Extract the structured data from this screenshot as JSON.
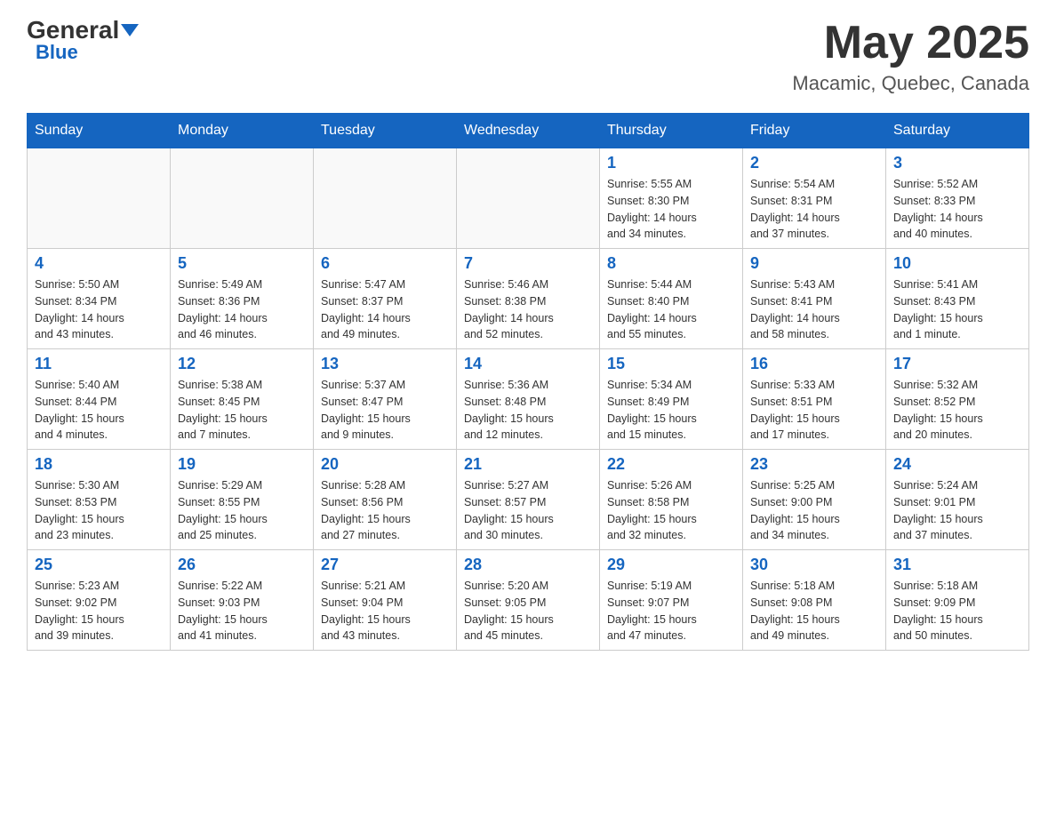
{
  "header": {
    "logo_general": "General",
    "logo_blue": "Blue",
    "month_title": "May 2025",
    "location": "Macamic, Quebec, Canada"
  },
  "weekdays": [
    "Sunday",
    "Monday",
    "Tuesday",
    "Wednesday",
    "Thursday",
    "Friday",
    "Saturday"
  ],
  "weeks": [
    [
      {
        "day": "",
        "info": ""
      },
      {
        "day": "",
        "info": ""
      },
      {
        "day": "",
        "info": ""
      },
      {
        "day": "",
        "info": ""
      },
      {
        "day": "1",
        "info": "Sunrise: 5:55 AM\nSunset: 8:30 PM\nDaylight: 14 hours\nand 34 minutes."
      },
      {
        "day": "2",
        "info": "Sunrise: 5:54 AM\nSunset: 8:31 PM\nDaylight: 14 hours\nand 37 minutes."
      },
      {
        "day": "3",
        "info": "Sunrise: 5:52 AM\nSunset: 8:33 PM\nDaylight: 14 hours\nand 40 minutes."
      }
    ],
    [
      {
        "day": "4",
        "info": "Sunrise: 5:50 AM\nSunset: 8:34 PM\nDaylight: 14 hours\nand 43 minutes."
      },
      {
        "day": "5",
        "info": "Sunrise: 5:49 AM\nSunset: 8:36 PM\nDaylight: 14 hours\nand 46 minutes."
      },
      {
        "day": "6",
        "info": "Sunrise: 5:47 AM\nSunset: 8:37 PM\nDaylight: 14 hours\nand 49 minutes."
      },
      {
        "day": "7",
        "info": "Sunrise: 5:46 AM\nSunset: 8:38 PM\nDaylight: 14 hours\nand 52 minutes."
      },
      {
        "day": "8",
        "info": "Sunrise: 5:44 AM\nSunset: 8:40 PM\nDaylight: 14 hours\nand 55 minutes."
      },
      {
        "day": "9",
        "info": "Sunrise: 5:43 AM\nSunset: 8:41 PM\nDaylight: 14 hours\nand 58 minutes."
      },
      {
        "day": "10",
        "info": "Sunrise: 5:41 AM\nSunset: 8:43 PM\nDaylight: 15 hours\nand 1 minute."
      }
    ],
    [
      {
        "day": "11",
        "info": "Sunrise: 5:40 AM\nSunset: 8:44 PM\nDaylight: 15 hours\nand 4 minutes."
      },
      {
        "day": "12",
        "info": "Sunrise: 5:38 AM\nSunset: 8:45 PM\nDaylight: 15 hours\nand 7 minutes."
      },
      {
        "day": "13",
        "info": "Sunrise: 5:37 AM\nSunset: 8:47 PM\nDaylight: 15 hours\nand 9 minutes."
      },
      {
        "day": "14",
        "info": "Sunrise: 5:36 AM\nSunset: 8:48 PM\nDaylight: 15 hours\nand 12 minutes."
      },
      {
        "day": "15",
        "info": "Sunrise: 5:34 AM\nSunset: 8:49 PM\nDaylight: 15 hours\nand 15 minutes."
      },
      {
        "day": "16",
        "info": "Sunrise: 5:33 AM\nSunset: 8:51 PM\nDaylight: 15 hours\nand 17 minutes."
      },
      {
        "day": "17",
        "info": "Sunrise: 5:32 AM\nSunset: 8:52 PM\nDaylight: 15 hours\nand 20 minutes."
      }
    ],
    [
      {
        "day": "18",
        "info": "Sunrise: 5:30 AM\nSunset: 8:53 PM\nDaylight: 15 hours\nand 23 minutes."
      },
      {
        "day": "19",
        "info": "Sunrise: 5:29 AM\nSunset: 8:55 PM\nDaylight: 15 hours\nand 25 minutes."
      },
      {
        "day": "20",
        "info": "Sunrise: 5:28 AM\nSunset: 8:56 PM\nDaylight: 15 hours\nand 27 minutes."
      },
      {
        "day": "21",
        "info": "Sunrise: 5:27 AM\nSunset: 8:57 PM\nDaylight: 15 hours\nand 30 minutes."
      },
      {
        "day": "22",
        "info": "Sunrise: 5:26 AM\nSunset: 8:58 PM\nDaylight: 15 hours\nand 32 minutes."
      },
      {
        "day": "23",
        "info": "Sunrise: 5:25 AM\nSunset: 9:00 PM\nDaylight: 15 hours\nand 34 minutes."
      },
      {
        "day": "24",
        "info": "Sunrise: 5:24 AM\nSunset: 9:01 PM\nDaylight: 15 hours\nand 37 minutes."
      }
    ],
    [
      {
        "day": "25",
        "info": "Sunrise: 5:23 AM\nSunset: 9:02 PM\nDaylight: 15 hours\nand 39 minutes."
      },
      {
        "day": "26",
        "info": "Sunrise: 5:22 AM\nSunset: 9:03 PM\nDaylight: 15 hours\nand 41 minutes."
      },
      {
        "day": "27",
        "info": "Sunrise: 5:21 AM\nSunset: 9:04 PM\nDaylight: 15 hours\nand 43 minutes."
      },
      {
        "day": "28",
        "info": "Sunrise: 5:20 AM\nSunset: 9:05 PM\nDaylight: 15 hours\nand 45 minutes."
      },
      {
        "day": "29",
        "info": "Sunrise: 5:19 AM\nSunset: 9:07 PM\nDaylight: 15 hours\nand 47 minutes."
      },
      {
        "day": "30",
        "info": "Sunrise: 5:18 AM\nSunset: 9:08 PM\nDaylight: 15 hours\nand 49 minutes."
      },
      {
        "day": "31",
        "info": "Sunrise: 5:18 AM\nSunset: 9:09 PM\nDaylight: 15 hours\nand 50 minutes."
      }
    ]
  ]
}
